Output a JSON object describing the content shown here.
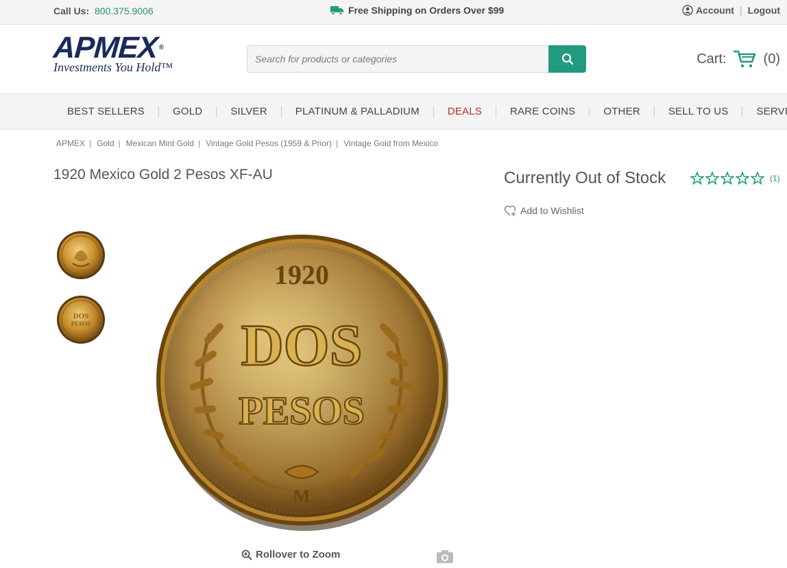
{
  "topbar": {
    "call_label": "Call Us:",
    "phone": "800.375.9006",
    "shipping": "Free Shipping on Orders Over $99",
    "account": "Account",
    "logout": "Logout",
    "separator": "|"
  },
  "header": {
    "logo_word": "APMEX",
    "logo_reg": "®",
    "logo_tagline": "Investments You Hold™",
    "search_placeholder": "Search for products or categories",
    "cart_label": "Cart:",
    "cart_count": "(0)"
  },
  "nav": {
    "items": [
      "BEST SELLERS",
      "GOLD",
      "SILVER",
      "PLATINUM & PALLADIUM",
      "DEALS",
      "RARE COINS",
      "OTHER",
      "SELL TO US",
      "SERVICES"
    ]
  },
  "breadcrumb": {
    "items": [
      "APMEX",
      "Gold",
      "Mexican Mint Gold",
      "Vintage Gold Pesos (1959 & Prior)",
      "Vintage Gold from Mexico"
    ],
    "separator": "|"
  },
  "product": {
    "title": "1920 Mexico Gold 2 Pesos XF-AU",
    "stock_status": "Currently Out of Stock",
    "rating_stars": 5,
    "review_count": "(1)",
    "wishlist": "Add to Wishlist",
    "coin_year": "1920",
    "coin_line1": "DOS",
    "coin_line2": "PESOS",
    "coin_mint": "M",
    "zoom_label": "Rollover to Zoom"
  },
  "colors": {
    "accent": "#219a7f",
    "deals": "#c0272d",
    "brand": "#1a2a5a"
  },
  "icons": {
    "truck": "truck-icon",
    "account": "user-circle-icon",
    "search": "search-icon",
    "cart": "cart-icon",
    "star": "star-outline-icon",
    "heart": "heart-plus-icon",
    "zoom": "zoom-in-icon",
    "camera": "camera-icon"
  }
}
